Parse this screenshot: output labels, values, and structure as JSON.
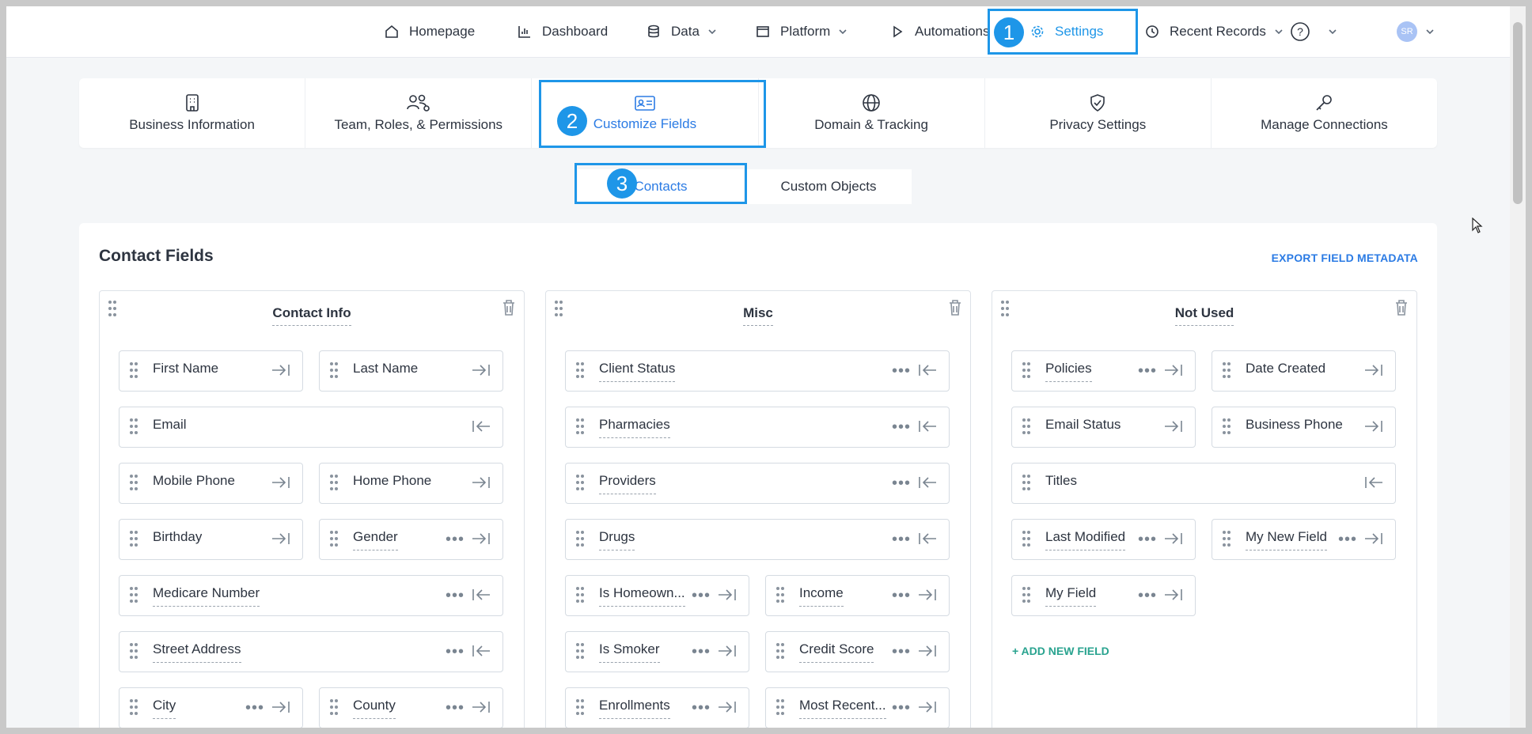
{
  "nav": {
    "homepage": "Homepage",
    "dashboard": "Dashboard",
    "data": "Data",
    "platform": "Platform",
    "automations": "Automations",
    "settings": "Settings",
    "recent_records": "Recent Records",
    "help": "?",
    "avatar_initials": "SR"
  },
  "steps": {
    "one": "1",
    "two": "2",
    "three": "3"
  },
  "tabs": [
    {
      "label": "Business Information",
      "icon": "building-icon"
    },
    {
      "label": "Team, Roles, & Permissions",
      "icon": "team-settings-icon"
    },
    {
      "label": "Customize Fields",
      "icon": "id-card-icon"
    },
    {
      "label": "Domain & Tracking",
      "icon": "globe-icon"
    },
    {
      "label": "Privacy Settings",
      "icon": "shield-check-icon"
    },
    {
      "label": "Manage Connections",
      "icon": "key-icon"
    }
  ],
  "subtabs": {
    "contacts": "Contacts",
    "custom_objects": "Custom Objects"
  },
  "panel": {
    "title": "Contact Fields",
    "export_label": "EXPORT FIELD METADATA",
    "add_field_label": "+ ADD NEW FIELD"
  },
  "groups": {
    "contact_info": {
      "title": "Contact Info",
      "fields": [
        "First Name",
        "Last Name",
        "Email",
        "Mobile Phone",
        "Home Phone",
        "Birthday",
        "Gender",
        "Medicare Number",
        "Street Address",
        "City",
        "County"
      ]
    },
    "misc": {
      "title": "Misc",
      "fields": [
        "Client Status",
        "Pharmacies",
        "Providers",
        "Drugs",
        "Is Homeown...",
        "Income",
        "Is Smoker",
        "Credit Score",
        "Enrollments",
        "Most Recent..."
      ]
    },
    "not_used": {
      "title": "Not Used",
      "fields": [
        "Policies",
        "Date Created",
        "Email Status",
        "Business Phone",
        "Titles",
        "Last Modified",
        "My New Field",
        "My Field"
      ]
    }
  },
  "colors": {
    "accent": "#2b7be4",
    "highlight": "#1e96e8",
    "add_field": "#29a38f"
  }
}
